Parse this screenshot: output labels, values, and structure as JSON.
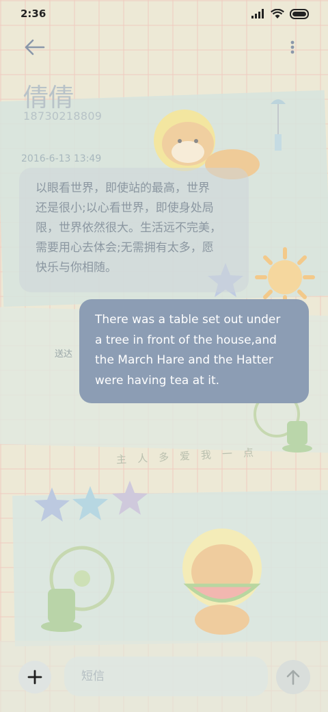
{
  "status_bar": {
    "time": "2:36",
    "icons": [
      "signal-icon",
      "wifi-icon",
      "battery-icon"
    ]
  },
  "toolbar": {
    "back_icon": "back-arrow-icon",
    "more_icon": "more-vertical-icon"
  },
  "contact": {
    "name": "倩倩",
    "number": "18730218809"
  },
  "messages": [
    {
      "direction": "incoming",
      "timestamp": "2016-6-13 13:49",
      "lines": [
        "以眼看世界，即使站的最高，世界",
        "还是很小;以心看世界，即使身处局",
        "限，世界依然很大。生活远不完美，",
        "需要用心去体会;无需拥有太多，愿",
        "快乐与你相随。"
      ]
    },
    {
      "direction": "outgoing",
      "status": "送达",
      "lines": [
        "There was a table set out under",
        "a tree in front of the house,and",
        "the March Hare and the Hatter",
        "were having tea at it."
      ]
    }
  ],
  "wallpaper": {
    "handwriting": "主人多爱我一点"
  },
  "composer": {
    "add_icon": "plus-icon",
    "placeholder": "短信",
    "value": "",
    "send_icon": "send-arrow-icon"
  },
  "colors": {
    "outgoing_bubble": "#8c9db4",
    "incoming_bubble": "#cdd6d8",
    "background": "#ede9d6"
  }
}
